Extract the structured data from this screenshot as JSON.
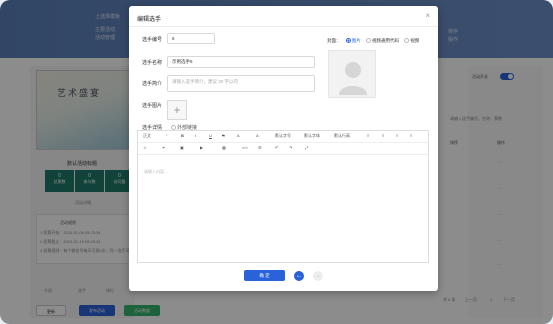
{
  "background": {
    "header_texts": [
      "上选择模板",
      "主要活动",
      "活动管理"
    ],
    "header_right_texts": [
      "排序",
      "操作"
    ],
    "banner_art_text": "艺术盛宴",
    "activity_title": "默认活动标题",
    "stats": [
      {
        "value": "0",
        "label": "总票数"
      },
      {
        "value": "0",
        "label": "参与数"
      },
      {
        "value": "0",
        "label": "访问量"
      }
    ],
    "activity_subtext": "活动详情",
    "info_title": "活动规则",
    "info_lines": [
      "1.投票开始：2024-01-09 05:23:34",
      "2.投票截止：2024-01-16 05:23:34",
      "3.投票规则：每个微信号每天可投5次，同一选手可投1次"
    ],
    "bottom_icons": [
      "介绍",
      "选手",
      "排行",
      "参与"
    ],
    "bottom_buttons": [
      "更新",
      "发布活动",
      "活动数据"
    ],
    "right_toggle_label": "活动开关",
    "right_search_placeholder": "请输入选手编号、名称、票数",
    "right_headers": [
      "排序",
      "操作"
    ],
    "right_rows": [
      "···",
      "···",
      "···",
      "···",
      "···",
      "···"
    ],
    "pagination": {
      "total": "共 6 条",
      "prev": "上一页",
      "page": "1",
      "next": "下一页"
    },
    "colors": {
      "header": "#6d8fc7",
      "stat": "#1f7a6a",
      "primary": "#2a62d9",
      "green": "#34b36b"
    }
  },
  "modal": {
    "title": "编辑选手",
    "close_icon": "close-icon",
    "fields": {
      "number": {
        "label": "选手编号",
        "value": "6"
      },
      "name": {
        "label": "选手名称",
        "value": "示例选手6"
      },
      "intro": {
        "label": "选手简介",
        "placeholder": "请输入选手简介，建议 30 字以内"
      },
      "images": {
        "label": "选手图片"
      },
      "details": {
        "label": "选手详情",
        "option": "外部链接"
      }
    },
    "cover": {
      "label": "封面：",
      "options": [
        "图片",
        "视频通用代码",
        "视频"
      ],
      "selected": "图片"
    },
    "editor": {
      "toolbar_row1": [
        "正文",
        "“",
        "B",
        "I",
        "U",
        "S",
        "A",
        "A",
        "默认字号",
        "默认字体",
        "默认行高",
        "≡",
        "≡",
        "≡",
        "≡"
      ],
      "toolbar_row2": [
        "☺",
        "⚭",
        "▣",
        "▶",
        "▦",
        "</>",
        "☰",
        "↶",
        "↷",
        "⤢"
      ],
      "placeholder": "请输入内容..."
    },
    "confirm_label": "确 定",
    "prev_icon": "arrow-left-icon",
    "next_icon": "arrow-right-icon"
  }
}
